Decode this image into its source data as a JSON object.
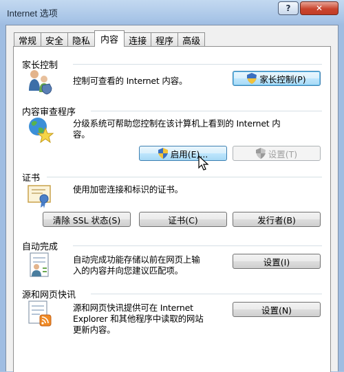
{
  "window": {
    "title": "Internet 选项"
  },
  "titlebar": {
    "help": "?",
    "close": "✕"
  },
  "tabs": [
    "常规",
    "安全",
    "隐私",
    "内容",
    "连接",
    "程序",
    "高级"
  ],
  "active_tab": "内容",
  "parental": {
    "title": "家长控制",
    "desc": "控制可查看的 Internet 内容。",
    "button": "家长控制(P)"
  },
  "advisor": {
    "title": "内容审查程序",
    "desc_line1": "分级系统可帮助您控制在该计算机上看到的 Internet 内",
    "desc_line2": "容。",
    "enable_button": "启用(E)...",
    "settings_button": "设置(T)"
  },
  "certificates": {
    "title": "证书",
    "desc": "使用加密连接和标识的证书。",
    "clear_ssl_button": "清除 SSL 状态(S)",
    "certs_button": "证书(C)",
    "publishers_button": "发行者(B)"
  },
  "autocomplete": {
    "title": "自动完成",
    "desc_line1": "自动完成功能存储以前在网页上输",
    "desc_line2": "入的内容并向您建议匹配项。",
    "settings_button": "设置(I)"
  },
  "feeds": {
    "title": "源和网页快讯",
    "desc_line1": "源和网页快讯提供可在 Internet",
    "desc_line2": "Explorer 和其他程序中读取的网站",
    "desc_line3": "更新内容。",
    "settings_button": "设置(N)"
  }
}
